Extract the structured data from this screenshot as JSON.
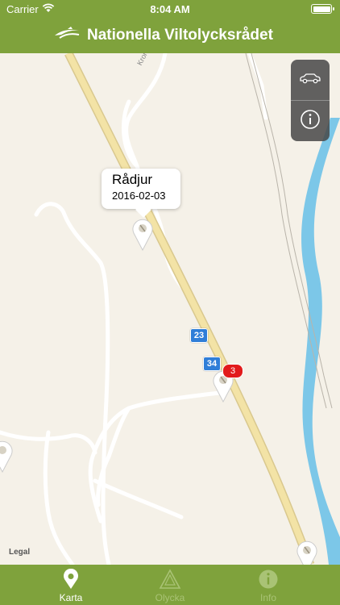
{
  "status_bar": {
    "carrier": "Carrier",
    "time": "8:04 AM"
  },
  "nav": {
    "title": "Nationella Viltolycksrådet"
  },
  "map": {
    "road_label": "Kronsnäs",
    "route_shields": [
      "23",
      "34"
    ],
    "callout": {
      "title": "Rådjur",
      "date": "2016-02-03"
    },
    "cluster_count": "3",
    "legal": "Legal"
  },
  "controls": {
    "car_icon": "car-icon",
    "info_icon": "info-icon"
  },
  "tabs": [
    {
      "label": "Karta",
      "icon": "map-pin-icon",
      "active": true
    },
    {
      "label": "Olycka",
      "icon": "warning-triangle-icon",
      "active": false
    },
    {
      "label": "Info",
      "icon": "info-icon",
      "active": false
    }
  ],
  "colors": {
    "brand": "#7fa23c",
    "water": "#7cc7e8",
    "road_major": "#f3e3a6",
    "badge": "#e21b1b",
    "shield": "#2f7ed8"
  }
}
